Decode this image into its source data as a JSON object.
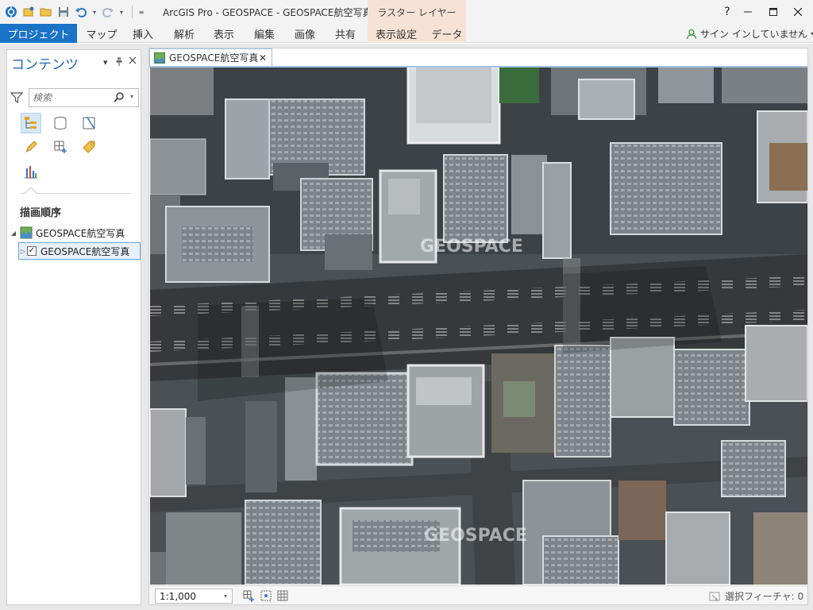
{
  "titlebar": {
    "title": "ArcGIS Pro - GEOSPACE - GEOSPACE航空写真",
    "contextual_group": "ラスター レイヤー",
    "window_buttons": [
      "?",
      "minimize",
      "maximize",
      "close"
    ]
  },
  "ribbon": {
    "tabs": [
      "プロジェクト",
      "マップ",
      "挿入",
      "解析",
      "表示",
      "編集",
      "画像",
      "共有",
      "表示設定",
      "データ"
    ],
    "signin": "サイン インしていません"
  },
  "contents": {
    "title": "コンテンツ",
    "search_placeholder": "検索",
    "draw_order_label": "描画順序",
    "map_name": "GEOSPACE航空写真",
    "layer_name": "GEOSPACE航空写真",
    "layer_checked": true
  },
  "mapview": {
    "tab_label": "GEOSPACE航空写真",
    "watermark": "GEOSPACE",
    "scale": "1:1,000",
    "selected_features": "選択フィーチャ: 0"
  },
  "colors": {
    "accent": "#1a73c7",
    "contextual_tab": "#f7e3d6",
    "pane_title": "#1c6bb5",
    "selection_outline": "#6aa6da"
  }
}
